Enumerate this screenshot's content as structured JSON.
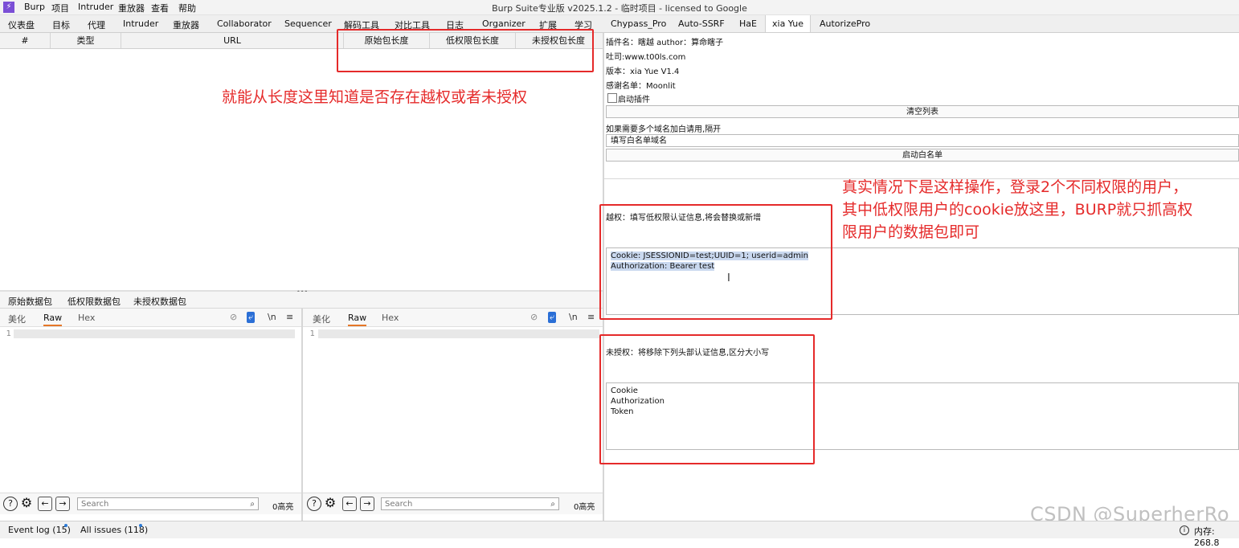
{
  "window": {
    "title": "Burp Suite专业版  v2025.1.2 - 临时项目 - licensed to Google",
    "menu": [
      "Burp",
      "项目",
      "Intruder",
      "重放器",
      "查看",
      "帮助"
    ]
  },
  "tabs": [
    "仪表盘",
    "目标",
    "代理",
    "Intruder",
    "重放器",
    "Collaborator",
    "Sequencer",
    "解码工具",
    "对比工具",
    "日志",
    "Organizer",
    "扩展",
    "学习",
    "Chypass_Pro",
    "Auto-SSRF",
    "HaE",
    "xia Yue",
    "AutorizePro"
  ],
  "active_tab": "xia Yue",
  "table": {
    "columns": [
      "#",
      "类型",
      "URL",
      "原始包长度",
      "低权限包长度",
      "未授权包长度"
    ]
  },
  "annotations": {
    "top": "就能从长度这里知道是否存在越权或者未授权",
    "right": [
      "真实情况下是这样操作，登录2个不同权限的用户，",
      "其中低权限用户的cookie放这里，BURP就只抓高权",
      "限用户的数据包即可"
    ]
  },
  "packet_tabs": [
    "原始数据包",
    "低权限数据包",
    "未授权数据包"
  ],
  "editor": {
    "subtabs": [
      "美化",
      "Raw",
      "Hex"
    ],
    "newline_label": "\\n",
    "menu_icon": "≡",
    "line_number": "1",
    "search_placeholder": "Search",
    "highlights": "0高亮"
  },
  "plugin": {
    "name_line": "插件名：瞎越 author：算命瞎子",
    "tusi_line": "吐司:www.t00ls.com",
    "version_line": "版本：xia Yue V1.4",
    "thanks_line": "感谢名单：Moonlit",
    "enable_label": "启动插件",
    "clear_button": "清空列表",
    "whitelist_hint": "如果需要多个域名加白请用,隔开",
    "whitelist_input": "填写白名单域名",
    "whitelist_button": "启动白名单",
    "yuequan_label": "越权：填写低权限认证信息,将会替换或新增",
    "yuequan_lines": [
      "Cookie: JSESSIONID=test;UUID=1; userid=admin",
      "Authorization: Bearer test"
    ],
    "weishouquan_label": "未授权：将移除下列头部认证信息,区分大小写",
    "weishouquan_lines": [
      "Cookie",
      "Authorization",
      "Token"
    ]
  },
  "status": {
    "event_log": "Event log (15)",
    "all_issues": "All issues (118)",
    "memory": "内存: 268.8"
  },
  "watermark": "CSDN @SuperherRo",
  "colors": {
    "annotation_red": "#e52a2a",
    "active_tab_accent": "#e57728",
    "burp_logo": "#7b4fd6"
  }
}
